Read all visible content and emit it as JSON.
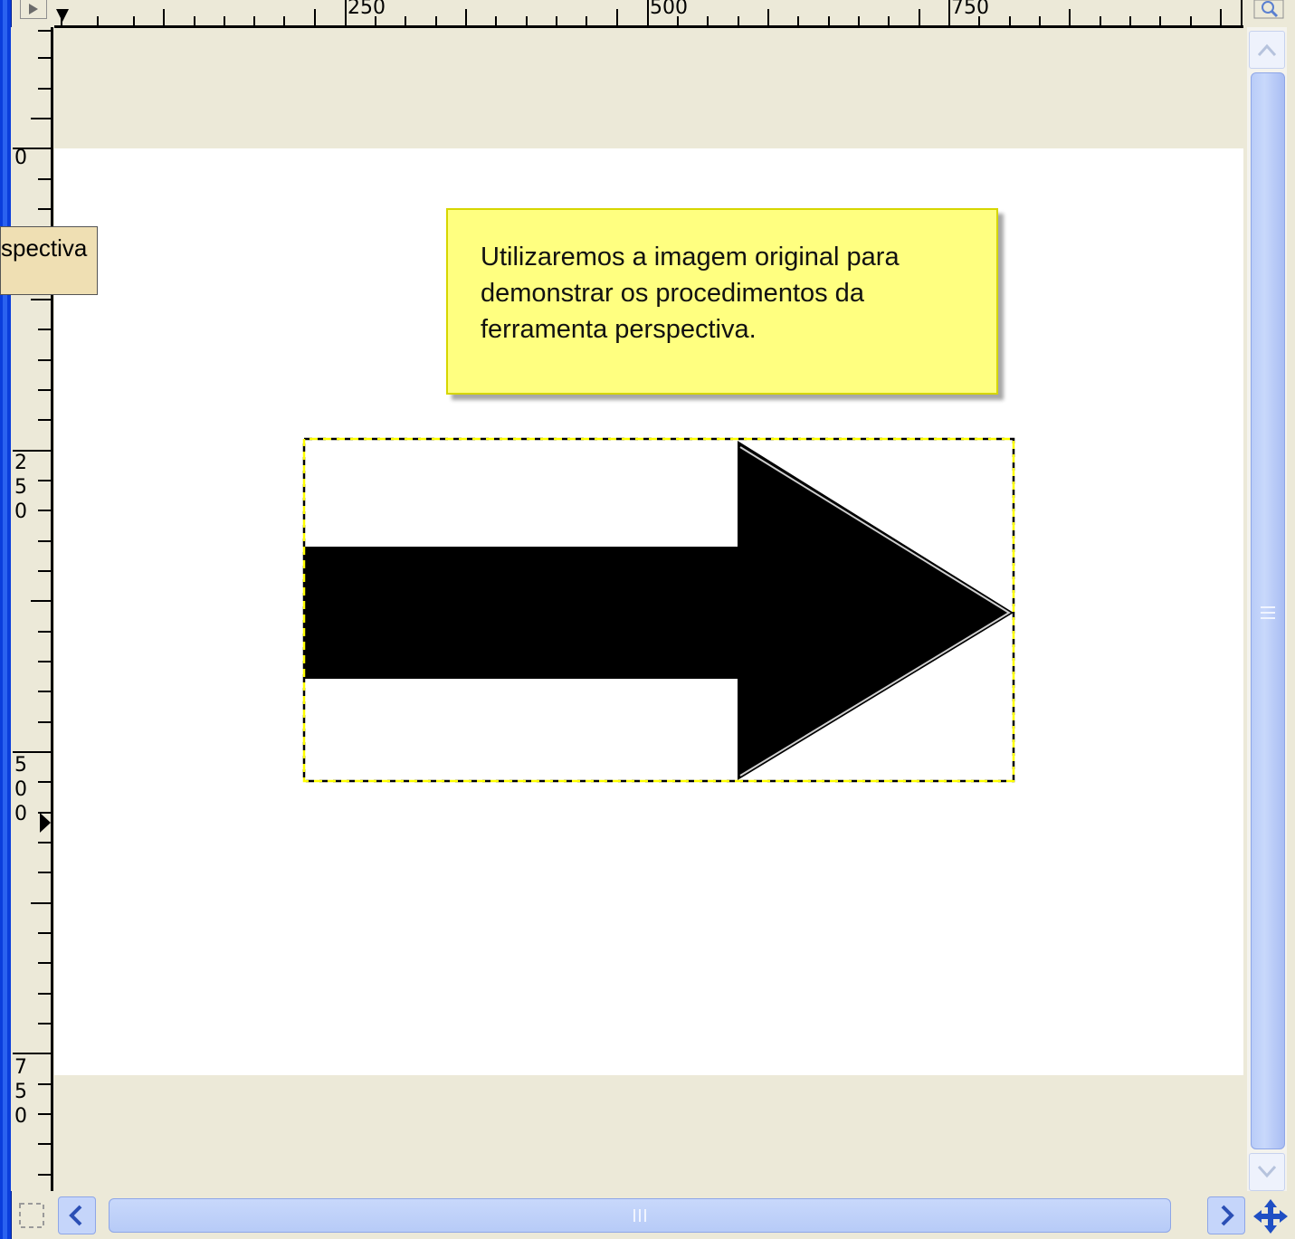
{
  "ruler": {
    "horizontal_labels": [
      "250",
      "500",
      "750"
    ],
    "vertical_labels": [
      "0",
      "250",
      "500",
      "750"
    ]
  },
  "tooltip": {
    "text": "spectiva"
  },
  "note": {
    "lines": [
      "Utilizaremos a imagem original para",
      "demonstrar os procedimentos da",
      "ferramenta perspectiva."
    ]
  },
  "colors": {
    "frame_blue": "#0a3ddc",
    "canvas_bg": "#ece9d8",
    "note_bg": "#ffff80",
    "selection_dash": "#ffff00",
    "scroll_thumb": "#c8d8fb"
  },
  "icons": {
    "top_left": "menu-arrow-icon",
    "top_right": "zoom-icon",
    "bottom_left": "quick-mask-icon",
    "bottom_right": "navigate-icon"
  }
}
